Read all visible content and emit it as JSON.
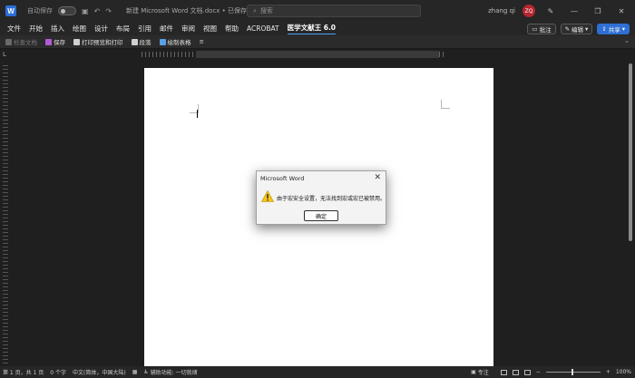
{
  "titlebar": {
    "autosave_label": "自动保存",
    "autosave_state": "关",
    "document_title": "新建 Microsoft Word 文档.docx • 已保存到这台电脑",
    "search_placeholder": "搜索",
    "user_name": "zhang qi",
    "user_initials": "ZQ"
  },
  "menu": {
    "items": [
      "文件",
      "开始",
      "插入",
      "绘图",
      "设计",
      "布局",
      "引用",
      "邮件",
      "审阅",
      "视图",
      "帮助",
      "ACROBAT",
      "医学文献王 6.0"
    ],
    "active_index": 12,
    "comment_label": "批注",
    "edit_label": "编辑",
    "share_label": "共享"
  },
  "ribbon": {
    "check_doc": "检查文档",
    "save": "保存",
    "print_preview": "打印预览和打印",
    "paragraph": "段落",
    "draw_table": "绘制表格"
  },
  "dialog": {
    "title": "Microsoft Word",
    "message": "由于宏安全设置，无法找到宏或宏已被禁用。",
    "ok_label": "确定"
  },
  "statusbar": {
    "page": "第 1 页，共 1 页",
    "words": "0 个字",
    "language": "中文(简体，中国大陆)",
    "accessibility": "辅助功能: 一切就绪",
    "focus": "专注",
    "zoom": "100%"
  },
  "colors": {
    "accent": "#4ea1ff",
    "share": "#2f6fd4",
    "avatar": "#b3262f",
    "background": "#1f1f1f"
  }
}
